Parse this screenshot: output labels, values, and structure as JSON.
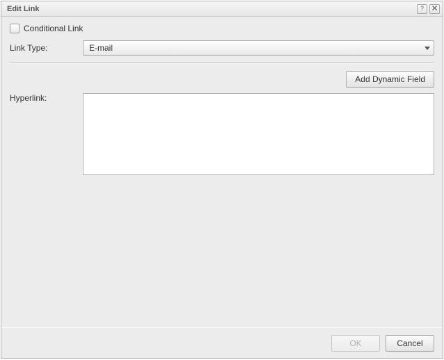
{
  "dialog": {
    "title": "Edit Link"
  },
  "conditional": {
    "label": "Conditional Link",
    "checked": false
  },
  "linkType": {
    "label": "Link Type:",
    "value": "E-mail"
  },
  "buttons": {
    "addDynamicField": "Add Dynamic Field",
    "ok": "OK",
    "cancel": "Cancel"
  },
  "hyperlink": {
    "label": "Hyperlink:",
    "value": ""
  }
}
